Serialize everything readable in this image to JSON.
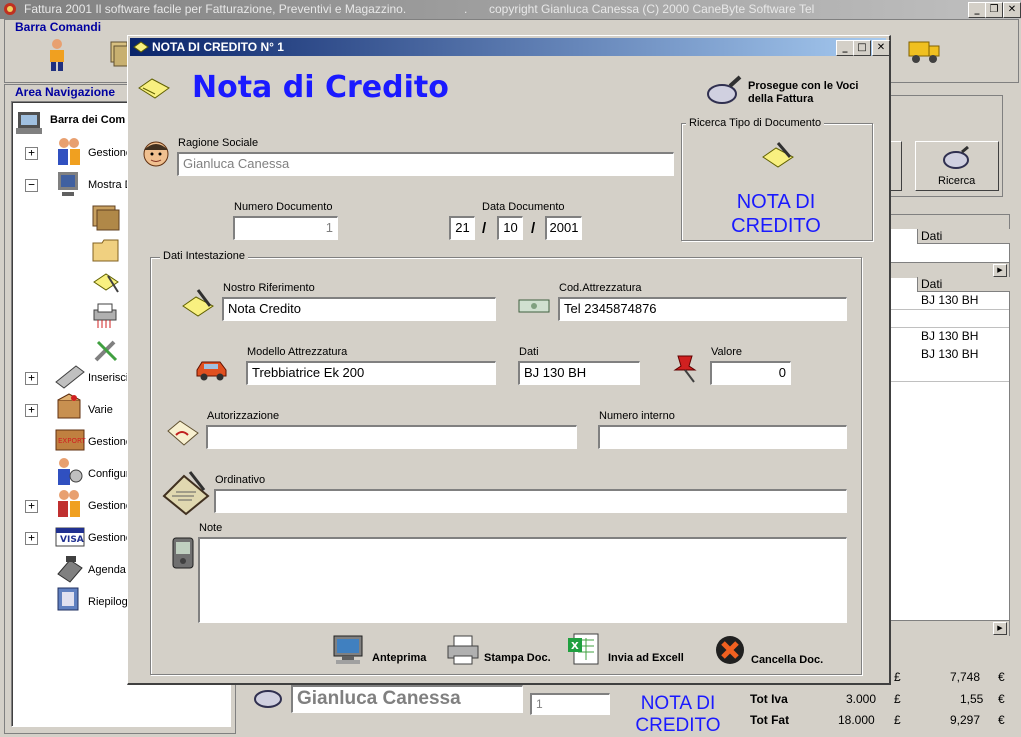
{
  "app": {
    "title": "Fattura 2001  Il software facile per Fatturazione, Preventivi e Magazzino.",
    "title_dots": ".",
    "copyright": "copyright Gianluca Canessa (C) 2000 CaneByte Software  Tel",
    "controls": {
      "min": "_",
      "restore": "❐",
      "close": "✕"
    }
  },
  "command_bar": {
    "label": "Barra Comandi"
  },
  "nav": {
    "label": "Area Navigazione",
    "root": "Barra dei Com",
    "items": [
      {
        "label": "Gestione",
        "expander": "+"
      },
      {
        "label": "Mostra D",
        "expander": "−"
      },
      {
        "label": "Inserisci",
        "expander": "+"
      },
      {
        "label": "Varie",
        "expander": "+"
      },
      {
        "label": "Gestione",
        "expander": ""
      },
      {
        "label": "Configur",
        "expander": ""
      },
      {
        "label": "Gestione",
        "expander": "+"
      },
      {
        "label": "Gestione",
        "expander": "+"
      },
      {
        "label": "Agenda",
        "expander": ""
      },
      {
        "label": "Riepilog",
        "expander": ""
      }
    ]
  },
  "background": {
    "search_button": "Ricerca",
    "grid_header_1": "Dati",
    "grid_header_2": "Dati",
    "grid_rows": [
      "BJ 130 BH",
      "",
      "BJ 130 BH",
      "BJ 130 BH"
    ],
    "customer_name": "Gianluca Canessa",
    "small_field": "1",
    "doc_type": "NOTA DI CREDITO",
    "totals": [
      {
        "label": "",
        "a": "",
        "cur1": "£",
        "b": "7,748",
        "cur2": "€"
      },
      {
        "label": "Tot Iva",
        "a": "3.000",
        "cur1": "£",
        "b": "1,55",
        "cur2": "€"
      },
      {
        "label": "Tot Fat",
        "a": "18.000",
        "cur1": "£",
        "b": "9,297",
        "cur2": "€"
      }
    ]
  },
  "dialog": {
    "title": "NOTA DI CREDITO N° 1",
    "heading": "Nota di Credito",
    "prosegue": "Prosegue con le Voci della Fattura",
    "ricerca_group": "Ricerca Tipo di Documento",
    "doc_type_line1": "NOTA DI",
    "doc_type_line2": "CREDITO",
    "ragione_sociale_label": "Ragione Sociale",
    "ragione_sociale": "Gianluca Canessa",
    "numero_doc_label": "Numero Documento",
    "numero_doc": "1",
    "data_doc_label": "Data Documento",
    "date": {
      "day": "21",
      "month": "10",
      "year": "2001",
      "sep": "/"
    },
    "intestazione_group": "Dati Intestazione",
    "nostro_rif_label": "Nostro Riferimento",
    "nostro_rif": "Nota Credito",
    "cod_attr_label": "Cod.Attrezzatura",
    "cod_attr": "Tel 2345874876",
    "modello_label": "Modello Attrezzatura",
    "modello": "Trebbiatrice Ek 200",
    "dati_label": "Dati",
    "dati": "BJ 130 BH",
    "valore_label": "Valore",
    "valore": "0",
    "autorizzazione_label": "Autorizzazione",
    "autorizzazione": "",
    "numero_interno_label": "Numero interno",
    "numero_interno": "",
    "ordinativo_label": "Ordinativo",
    "ordinativo": "",
    "note_label": "Note",
    "note": "",
    "buttons": {
      "anteprima": "Anteprima",
      "stampa": "Stampa Doc.",
      "excel": "Invia ad Excell",
      "cancella": "Cancella Doc."
    }
  },
  "colors": {
    "title_bar": "#0a246a",
    "heading": "#1a1aff",
    "nav_label": "#0000a0"
  }
}
